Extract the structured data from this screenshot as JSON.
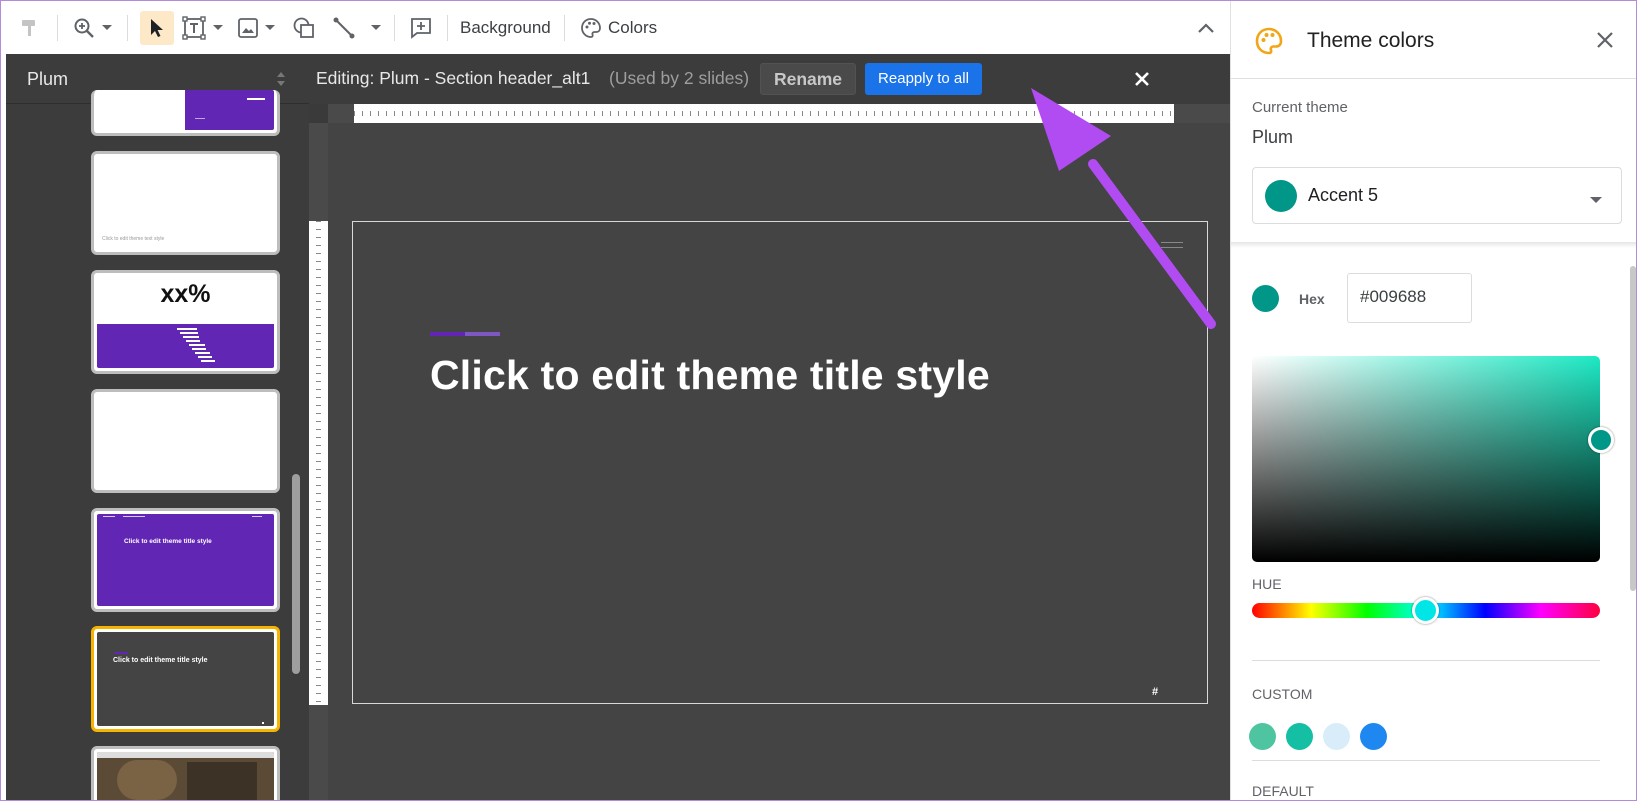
{
  "toolbar": {
    "background_label": "Background",
    "colors_label": "Colors"
  },
  "left_panel": {
    "theme_name": "Plum",
    "thumbnails": [
      {
        "text": ""
      },
      {
        "text": "Click to edit theme text style"
      },
      {
        "text": "xx%"
      },
      {
        "text": ""
      },
      {
        "text": "Click to edit theme title style"
      },
      {
        "text": "Click to edit theme title style"
      },
      {
        "text": ""
      }
    ]
  },
  "edit_bar": {
    "editing_label": "Editing: Plum - Section header_alt1",
    "used_by": "(Used by 2 slides)",
    "rename_label": "Rename",
    "reapply_label": "Reapply to all"
  },
  "slide": {
    "title": "Click to edit theme title style",
    "page_number": "#"
  },
  "theme_panel": {
    "title": "Theme colors",
    "current_theme_label": "Current theme",
    "current_theme_value": "Plum",
    "selected_color_name": "Accent 5",
    "hex_label": "Hex",
    "hex_value": "#009688",
    "hue_label": "HUE",
    "custom_label": "CUSTOM",
    "default_label": "DEFAULT",
    "custom_colors": [
      "#4fc4a1",
      "#14bfa3",
      "#d8ecfa",
      "#1e88f0"
    ],
    "accent_color": "#009688"
  },
  "colors": {
    "reapply_blue": "#1a73e8",
    "plum_purple": "#6126b4",
    "arrow": "#b04cf1",
    "selected_thumb_border": "#f4b400"
  }
}
